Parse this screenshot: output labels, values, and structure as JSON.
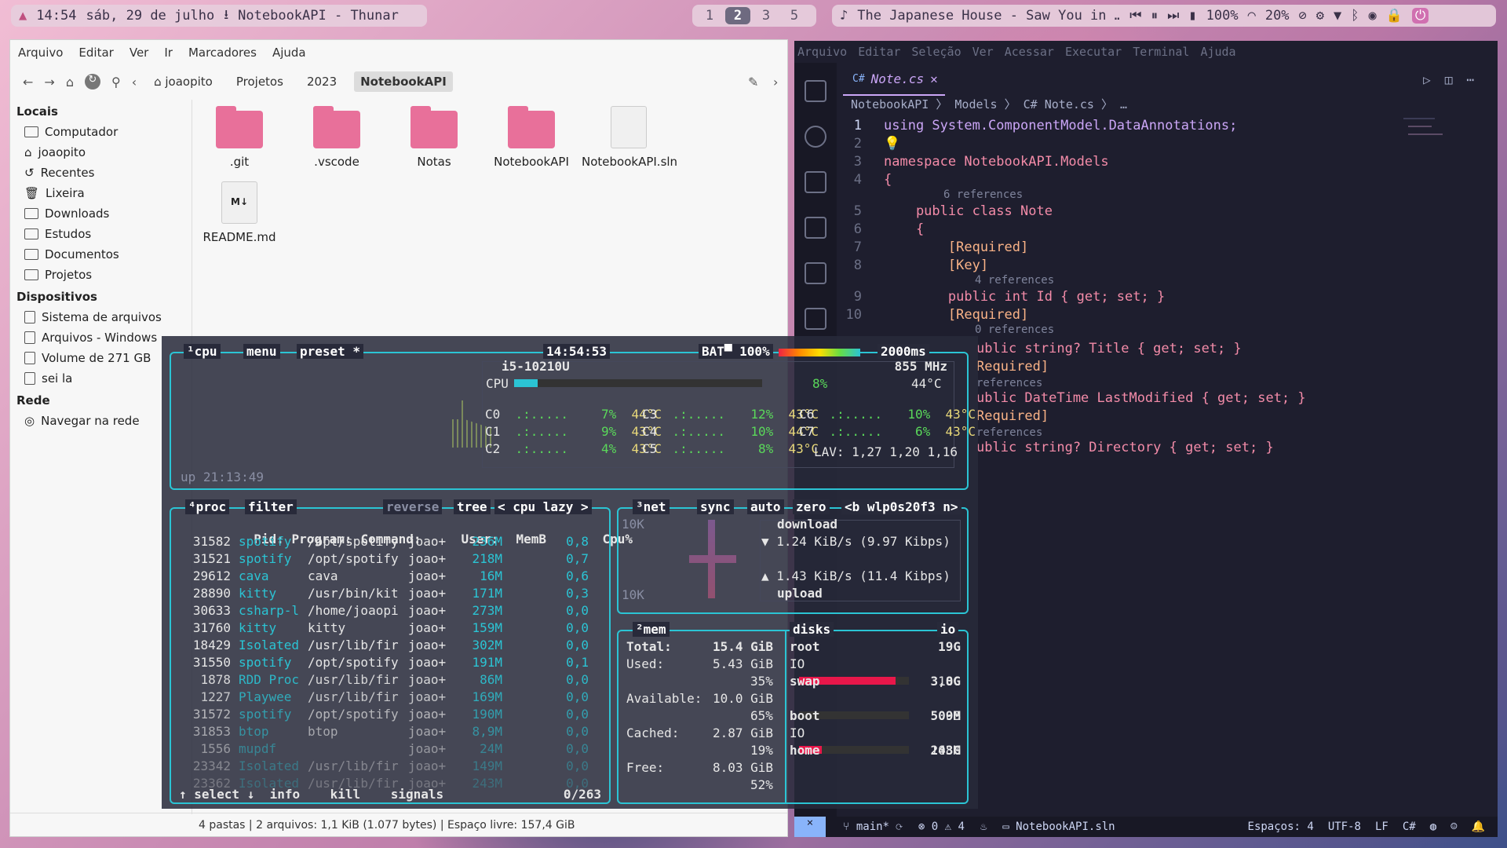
{
  "topbar": {
    "time": "14:54",
    "date": "sáb, 29 de julho",
    "window_title": "NotebookAPI - Thunar",
    "workspaces": [
      "1",
      "2",
      "3",
      "5"
    ],
    "active_workspace": "2",
    "media": "The Japanese House - Saw You in …",
    "battery": "100%",
    "volume": "20%"
  },
  "thunar": {
    "menu": [
      "Arquivo",
      "Editar",
      "Ver",
      "Ir",
      "Marcadores",
      "Ajuda"
    ],
    "breadcrumbs": [
      "joaopito",
      "Projetos",
      "2023",
      "NotebookAPI"
    ],
    "sidebar": {
      "locais_title": "Locais",
      "locais": [
        "Computador",
        "joaopito",
        "Recentes",
        "Lixeira",
        "Downloads",
        "Estudos",
        "Documentos",
        "Projetos"
      ],
      "dispositivos_title": "Dispositivos",
      "dispositivos": [
        "Sistema de arquivos",
        "Arquivos - Windows",
        "Volume de 271 GB",
        "sei la"
      ],
      "rede_title": "Rede",
      "rede": [
        "Navegar na rede"
      ]
    },
    "files": [
      ".git",
      ".vscode",
      "Notas",
      "NotebookAPI",
      "NotebookAPI.sln",
      "README.md"
    ],
    "status": "4 pastas  |  2 arquivos: 1,1 KiB (1.077 bytes)  |  Espaço livre: 157,4 GiB"
  },
  "vscode": {
    "menu": [
      "Arquivo",
      "Editar",
      "Seleção",
      "Ver",
      "Acessar",
      "Executar",
      "Terminal",
      "Ajuda"
    ],
    "tab": "Note.cs",
    "breadcrumbs": "NotebookAPI 〉 Models 〉 C# Note.cs 〉 …",
    "lines": [
      {
        "n": "1",
        "text": "using System.ComponentModel.DataAnnotations;"
      },
      {
        "n": "2",
        "text": "💡"
      },
      {
        "n": "3",
        "text": "namespace NotebookAPI.Models"
      },
      {
        "n": "4",
        "text": "{"
      },
      {
        "ref": "6 references"
      },
      {
        "n": "5",
        "text": "    public class Note"
      },
      {
        "n": "6",
        "text": "    {"
      },
      {
        "n": "7",
        "text": "        [Required]"
      },
      {
        "n": "8",
        "text": "        [Key]"
      },
      {
        "ref": "4 references"
      },
      {
        "n": "9",
        "text": "        public int Id { get; set; }"
      },
      {
        "n": "10",
        "text": "        [Required]"
      },
      {
        "ref": "0 references"
      }
    ],
    "overflow_lines": [
      "ublic string? Title { get; set; }",
      "Required]",
      "references",
      "ublic DateTime LastModified { get; set; }",
      "Required]",
      "references",
      "ublic string? Directory { get; set; }"
    ],
    "status": {
      "branch": "main*",
      "errors": "0",
      "warnings": "4",
      "solution": "NotebookAPI.sln",
      "spaces": "Espaços: 4",
      "encoding": "UTF-8",
      "eol": "LF",
      "lang": "C#"
    }
  },
  "btop": {
    "cpu_box": {
      "tabs": [
        "¹cpu",
        "menu",
        "preset *"
      ],
      "clock": "14:54:53",
      "battery": "BAT▀ 100%",
      "refresh": "2000ms",
      "cpu_model": "i5-10210U",
      "freq": "855 MHz",
      "cpu_total": "8%",
      "cpu_temp": "44°C",
      "cores": [
        {
          "name": "C0",
          "pct": "7%",
          "temp": "44°C"
        },
        {
          "name": "C1",
          "pct": "9%",
          "temp": "43°C"
        },
        {
          "name": "C2",
          "pct": "4%",
          "temp": "43°C"
        },
        {
          "name": "C3",
          "pct": "12%",
          "temp": "43°C"
        },
        {
          "name": "C4",
          "pct": "10%",
          "temp": "44°C"
        },
        {
          "name": "C5",
          "pct": "8%",
          "temp": "43°C"
        },
        {
          "name": "C6",
          "pct": "10%",
          "temp": "43°C"
        },
        {
          "name": "C7",
          "pct": "6%",
          "temp": "43°C"
        }
      ],
      "lav": "LAV: 1,27 1,20 1,16",
      "uptime": "up 21:13:49"
    },
    "proc_box": {
      "tabs": [
        "⁴proc",
        "filter",
        "reverse",
        "tree",
        "< cpu lazy >"
      ],
      "headers": [
        "Pid:",
        "Program:",
        "Command:",
        "User:",
        "MemB",
        "Cpu%"
      ],
      "rows": [
        {
          "pid": "31582",
          "prog": "spotify",
          "cmd": "/opt/spotify",
          "user": "joao+",
          "mem": "236M",
          "cpu": "0,8"
        },
        {
          "pid": "31521",
          "prog": "spotify",
          "cmd": "/opt/spotify",
          "user": "joao+",
          "mem": "218M",
          "cpu": "0,7"
        },
        {
          "pid": "29612",
          "prog": "cava",
          "cmd": "cava",
          "user": "joao+",
          "mem": "16M",
          "cpu": "0,6"
        },
        {
          "pid": "28890",
          "prog": "kitty",
          "cmd": "/usr/bin/kit",
          "user": "joao+",
          "mem": "171M",
          "cpu": "0,3"
        },
        {
          "pid": "30633",
          "prog": "csharp-l",
          "cmd": "/home/joaopi",
          "user": "joao+",
          "mem": "273M",
          "cpu": "0,0"
        },
        {
          "pid": "31760",
          "prog": "kitty",
          "cmd": "kitty",
          "user": "joao+",
          "mem": "159M",
          "cpu": "0,0"
        },
        {
          "pid": "18429",
          "prog": "Isolated",
          "cmd": "/usr/lib/fir",
          "user": "joao+",
          "mem": "302M",
          "cpu": "0,0"
        },
        {
          "pid": "31550",
          "prog": "spotify",
          "cmd": "/opt/spotify",
          "user": "joao+",
          "mem": "191M",
          "cpu": "0,1"
        },
        {
          "pid": "1878",
          "prog": "RDD Proc",
          "cmd": "/usr/lib/fir",
          "user": "joao+",
          "mem": "86M",
          "cpu": "0,0"
        },
        {
          "pid": "1227",
          "prog": "Playwee",
          "cmd": "/usr/lib/fir",
          "user": "joao+",
          "mem": "169M",
          "cpu": "0,0"
        },
        {
          "pid": "31572",
          "prog": "spotify",
          "cmd": "/opt/spotify",
          "user": "joao+",
          "mem": "190M",
          "cpu": "0,0"
        },
        {
          "pid": "31853",
          "prog": "btop",
          "cmd": "btop",
          "user": "joao+",
          "mem": "8,9M",
          "cpu": "0,0"
        },
        {
          "pid": "1556",
          "prog": "mupdf",
          "cmd": "",
          "user": "joao+",
          "mem": "24M",
          "cpu": "0,0"
        },
        {
          "pid": "23342",
          "prog": "Isolated",
          "cmd": "/usr/lib/fir",
          "user": "joao+",
          "mem": "149M",
          "cpu": "0,0"
        },
        {
          "pid": "23362",
          "prog": "Isolated",
          "cmd": "/usr/lib/fir",
          "user": "joao+",
          "mem": "243M",
          "cpu": "0,0"
        }
      ],
      "footer_left": "↑ select ↓  info    kill    signals",
      "count": "0/263"
    },
    "net_box": {
      "tabs": [
        "³net",
        "sync",
        "auto",
        "zero",
        "<b wlp0s20f3 n>"
      ],
      "scale_top": "10K",
      "scale_bottom": "10K",
      "download_label": "download",
      "download": "▼ 1.24 KiB/s (9.97 Kibps)",
      "upload": "▲ 1.43 KiB/s (11.4 Kibps)",
      "upload_label": "upload"
    },
    "mem_box": {
      "tabs": [
        "²mem",
        "disks",
        "io"
      ],
      "total_label": "Total:",
      "total": "15.4 GiB",
      "used_label": "Used:",
      "used": "5.43 GiB",
      "used_pct": "35%",
      "avail_label": "Available:",
      "avail": "10.0 GiB",
      "avail_pct": "65%",
      "cached_label": "Cached:",
      "cached": "2.87 GiB",
      "cached_pct": "19%",
      "free_label": "Free:",
      "free": "8.03 GiB",
      "free_pct": "52%",
      "disks": [
        {
          "name": "root",
          "size": "19G",
          "io": "IO",
          "used": "18G",
          "fill": 0.88
        },
        {
          "name": "swap",
          "size": "3,0G",
          "io": "",
          "used": "0B",
          "fill": 0
        },
        {
          "name": "boot",
          "size": "509M",
          "io": "IO",
          "used": "108M",
          "fill": 0.21
        },
        {
          "name": "home",
          "size": "243G",
          "io": "",
          "used": "",
          "fill": 0
        }
      ]
    }
  }
}
